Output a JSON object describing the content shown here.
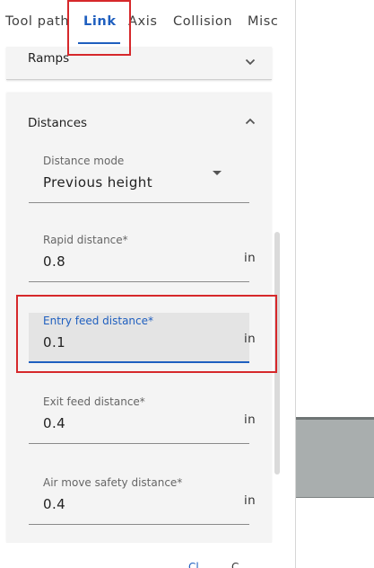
{
  "tabs": [
    {
      "label": "Tool path",
      "active": false
    },
    {
      "label": "Link",
      "active": true
    },
    {
      "label": "Axis",
      "active": false
    },
    {
      "label": "Collision",
      "active": false
    },
    {
      "label": "Misc",
      "active": false
    }
  ],
  "sections": {
    "ramps": {
      "title": "Ramps",
      "expanded": false,
      "icon": "chevron-down-icon"
    },
    "distances": {
      "title": "Distances",
      "expanded": true,
      "icon": "chevron-up-icon"
    }
  },
  "fields": {
    "distance_mode": {
      "label": "Distance mode",
      "value": "Previous height"
    },
    "rapid_distance": {
      "label": "Rapid distance*",
      "value": "0.8",
      "unit": "in"
    },
    "entry_feed_distance": {
      "label": "Entry feed distance*",
      "value": "0.1",
      "unit": "in"
    },
    "exit_feed_distance": {
      "label": "Exit feed distance*",
      "value": "0.4",
      "unit": "in"
    },
    "air_move_safety_distance": {
      "label": "Air move safety distance*",
      "value": "0.4",
      "unit": "in"
    }
  },
  "footer": {
    "link1": "Cl",
    "link2": "C"
  },
  "colors": {
    "accent": "#1f5fbf",
    "highlight": "#d6282b",
    "card_bg": "#f4f4f4",
    "focused_field_bg": "#e4e4e4"
  }
}
